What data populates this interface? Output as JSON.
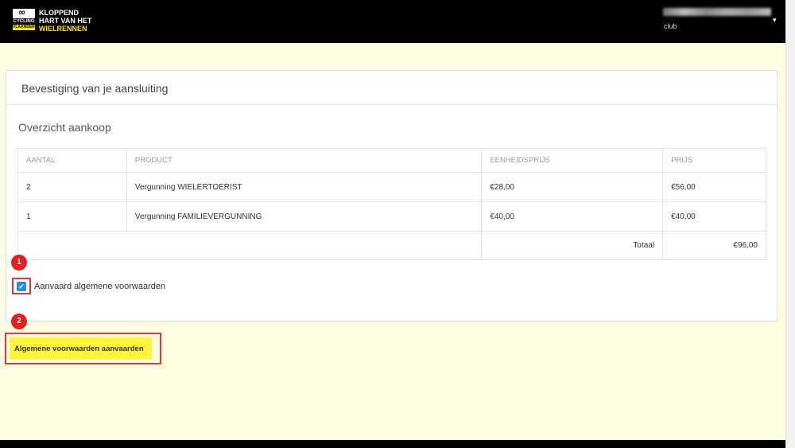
{
  "header": {
    "logo": {
      "symbol": "∞",
      "line1": "CYCLING",
      "line2": "VLAANDEREN"
    },
    "brand": {
      "line1": "KLOPPEND",
      "line2": "HART VAN HET",
      "line3": "WIELRENNEN"
    },
    "user": {
      "club_label": "club",
      "caret": "▾"
    }
  },
  "card": {
    "title": "Bevestiging van je aansluiting",
    "section_title": "Overzicht aankoop",
    "table": {
      "headers": [
        "AANTAL",
        "PRODUCT",
        "EENHEIDSPRIJS",
        "PRIJS"
      ],
      "rows": [
        [
          "2",
          "Vergunning WIELERTOERIST",
          "€28,00",
          "€56,00"
        ],
        [
          "1",
          "Vergunning FAMILIEVERGUNNING",
          "€40,00",
          "€40,00"
        ]
      ],
      "total_label": "Totaal",
      "total_value": "€96,00"
    },
    "agree_label": "Aanvaard algemene voorwaarden",
    "agree_checked": true
  },
  "annotations": {
    "badge1": "1",
    "badge2": "2",
    "accent": "#e32020"
  },
  "actions": {
    "accept_button": "Algemene voorwaarden aanvaarden"
  },
  "colors": {
    "page_bg": "#fdfde3",
    "header_bg": "#000000",
    "brand_yellow": "#ffe600",
    "button_yellow": "#fff53a",
    "checkbox_blue": "#2d8ce0"
  }
}
